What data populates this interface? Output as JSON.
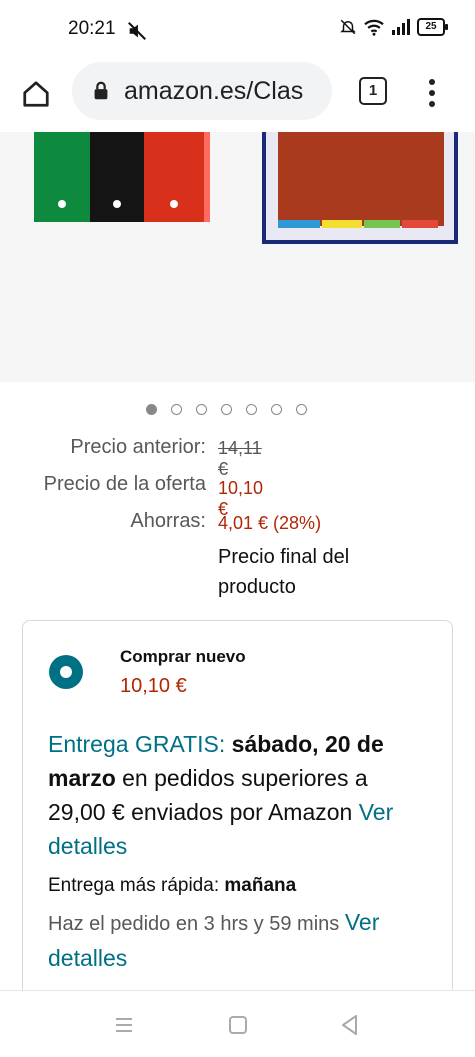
{
  "status_bar": {
    "time": "20:21",
    "battery": "25",
    "icons": [
      "mute-icon",
      "bell-off-icon",
      "wifi-icon",
      "signal-icon",
      "battery-icon"
    ]
  },
  "browser": {
    "url": "amazon.es/Clas",
    "tab_count": "1",
    "icons": [
      "home-icon",
      "lock-icon",
      "tabs-icon",
      "more-vert-icon"
    ]
  },
  "carousel": {
    "dot_count": 7,
    "active_index": 0
  },
  "pricing": {
    "previous_label": "Precio anterior:",
    "previous_value": "14,11 €",
    "offer_label": "Precio de la oferta",
    "offer_value": "10,10 €",
    "savings_label": "Ahorras:",
    "savings_value": "4,01 € (28%)",
    "final_note": "Precio final del producto"
  },
  "buy_box": {
    "title": "Comprar nuevo",
    "price": "10,10 €",
    "delivery_prefix": "Entrega GRATIS:",
    "delivery_date": "sábado, 20 de marzo",
    "delivery_suffix": " en pedidos superiores a 29,00 € enviados por Amazon",
    "details_link": "Ver detalles",
    "fast_label": "Entrega más rápida:",
    "fast_value": "mañana",
    "order_text": "Haz el pedido en 3 hrs y 59 mins",
    "order_link": "Ver detalles"
  },
  "colors": {
    "price_red": "#b12704",
    "link_teal": "#007185"
  }
}
